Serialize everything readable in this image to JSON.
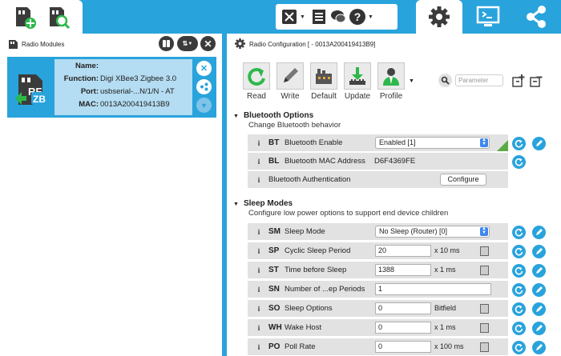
{
  "topbar": {
    "left_icons": [
      "add-module-icon",
      "discover-module-icon"
    ],
    "center_icons": [
      "tools-icon",
      "list-icon",
      "chat-icon",
      "help-icon"
    ],
    "right_tabs": [
      "configuration-gear-icon",
      "console-icon",
      "network-icon"
    ],
    "accent": "#29a3dc"
  },
  "left_panel": {
    "title": "Radio Modules",
    "module": {
      "fields": [
        {
          "key": "Name:",
          "value": ""
        },
        {
          "key": "Function:",
          "value": "Digi XBee3 Zigbee 3.0"
        },
        {
          "key": "Port:",
          "value": "usbserial-...N/1/N - AT"
        },
        {
          "key": "MAC:",
          "value": "0013A200419413B9"
        }
      ],
      "logo_text_top": "RF",
      "logo_text_bottom": "ZB"
    }
  },
  "right_panel": {
    "title": "Radio Configuration [  - 0013A200419413B9]",
    "toolbar": [
      {
        "label": "Read",
        "icon": "read-icon"
      },
      {
        "label": "Write",
        "icon": "write-icon"
      },
      {
        "label": "Default",
        "icon": "default-icon"
      },
      {
        "label": "Update",
        "icon": "update-icon"
      },
      {
        "label": "Profile",
        "icon": "profile-icon"
      }
    ],
    "search_placeholder": "Parameter",
    "sections": [
      {
        "title": "Bluetooth Options",
        "subtitle": "Change Bluetooth behavior",
        "params": [
          {
            "code": "BT",
            "name": "Bluetooth Enable",
            "kind": "select",
            "value": "Enabled [1]"
          },
          {
            "code": "BL",
            "name": "Bluetooth MAC Address",
            "kind": "readonly",
            "value": "D6F4369FE"
          },
          {
            "code": "",
            "name": "Bluetooth Authentication",
            "kind": "button",
            "value": "Configure"
          }
        ]
      },
      {
        "title": "Sleep Modes",
        "subtitle": "Configure low power options to support end device children",
        "params": [
          {
            "code": "SM",
            "name": "Sleep Mode",
            "kind": "select",
            "value": "No Sleep (Router) [0]"
          },
          {
            "code": "SP",
            "name": "Cyclic Sleep Period",
            "kind": "text",
            "value": "20",
            "unit": "x 10 ms"
          },
          {
            "code": "ST",
            "name": "Time before Sleep",
            "kind": "text",
            "value": "1388",
            "unit": "x 1 ms"
          },
          {
            "code": "SN",
            "name": "Number of ...ep Periods",
            "kind": "textwide",
            "value": "1",
            "unit": ""
          },
          {
            "code": "SO",
            "name": "Sleep Options",
            "kind": "text",
            "value": "0",
            "unit": "Bitfield"
          },
          {
            "code": "WH",
            "name": "Wake Host",
            "kind": "text",
            "value": "0",
            "unit": "x 1 ms"
          },
          {
            "code": "PO",
            "name": "Poll Rate",
            "kind": "text",
            "value": "0",
            "unit": "x 100 ms"
          }
        ]
      }
    ]
  }
}
